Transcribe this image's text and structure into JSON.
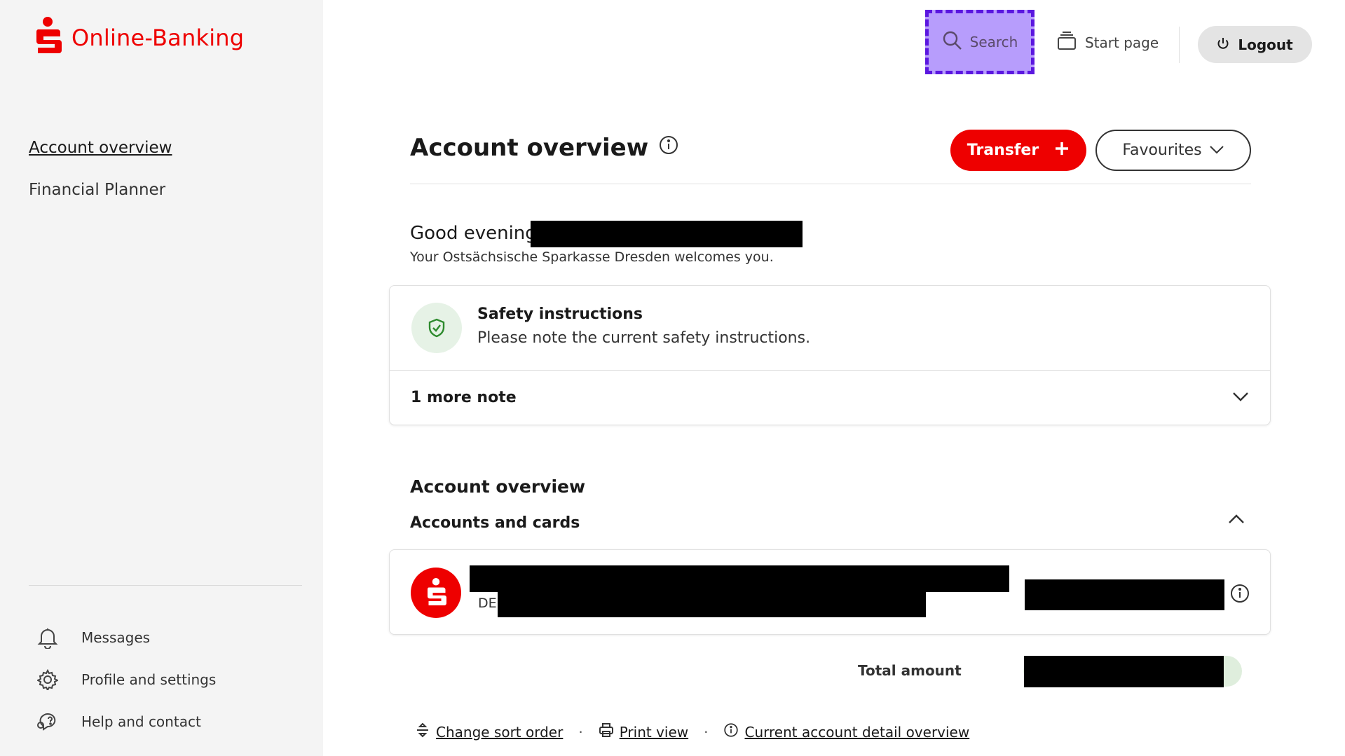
{
  "brand": {
    "name": "Online-Banking",
    "color": "#ee0000"
  },
  "sidebar": {
    "main_items": [
      {
        "label": "Account overview",
        "active": true
      },
      {
        "label": "Financial Planner",
        "active": false
      }
    ],
    "bottom_items": [
      {
        "label": "Messages",
        "icon": "bell-icon"
      },
      {
        "label": "Profile and settings",
        "icon": "gear-icon"
      },
      {
        "label": "Help and contact",
        "icon": "chat-help-icon"
      }
    ]
  },
  "header": {
    "search_label": "Search",
    "start_page_label": "Start page",
    "logout_label": "Logout"
  },
  "main": {
    "title": "Account overview",
    "transfer_label": "Transfer",
    "favourites_label": "Favourites",
    "greeting": "Good evening",
    "welcome": "Your Ostsächsische Sparkasse Dresden welcomes you.",
    "safety": {
      "title": "Safety instructions",
      "text": "Please note the current safety instructions.",
      "more": "1 more note"
    },
    "overview_heading": "Account overview",
    "accounts_heading": "Accounts and cards",
    "account": {
      "iban_prefix": "DE"
    },
    "total_label": "Total amount",
    "links": {
      "sort": "Change sort order",
      "print": "Print view",
      "detail": "Current account detail overview"
    }
  },
  "colors": {
    "accent_red": "#ee0000",
    "search_highlight": "#b79dfc",
    "search_border": "#5b17e0",
    "safety_green": "#2e8b2e"
  }
}
